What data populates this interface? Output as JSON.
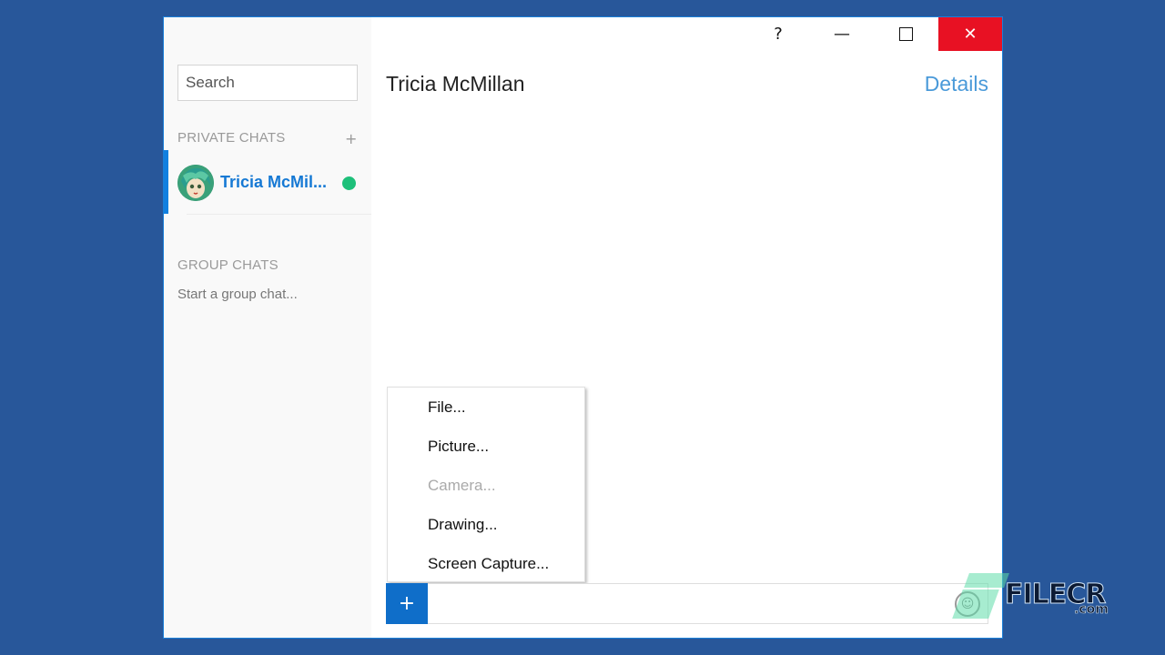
{
  "sidebar": {
    "search_placeholder": "Search",
    "private_chats_title": "PRIVATE CHATS",
    "add_private_chat": "+",
    "chats": [
      {
        "name": "Tricia McMil...",
        "status": "online",
        "selected": true
      }
    ],
    "group_chats_title": "GROUP CHATS",
    "start_group_chat": "Start a group chat..."
  },
  "titlebar": {
    "help": "?",
    "minimize": "—",
    "maximize": "☐",
    "close": "✕"
  },
  "conversation": {
    "contact_name": "Tricia McMillan",
    "details_link": "Details"
  },
  "attach_menu": {
    "items": [
      {
        "label": "File...",
        "enabled": true
      },
      {
        "label": "Picture...",
        "enabled": true
      },
      {
        "label": "Camera...",
        "enabled": false
      },
      {
        "label": "Drawing...",
        "enabled": true
      },
      {
        "label": "Screen Capture...",
        "enabled": true
      }
    ]
  },
  "composer": {
    "attach_button": "+",
    "message_value": "",
    "emoji_icon": "smiley-icon"
  },
  "watermark": {
    "text": "FILECR",
    "suffix": ".com"
  },
  "colors": {
    "accent": "#0f6ec9",
    "close": "#e81123",
    "online": "#1ec07a",
    "link": "#4a9ad9",
    "desktop": "#28579a"
  }
}
